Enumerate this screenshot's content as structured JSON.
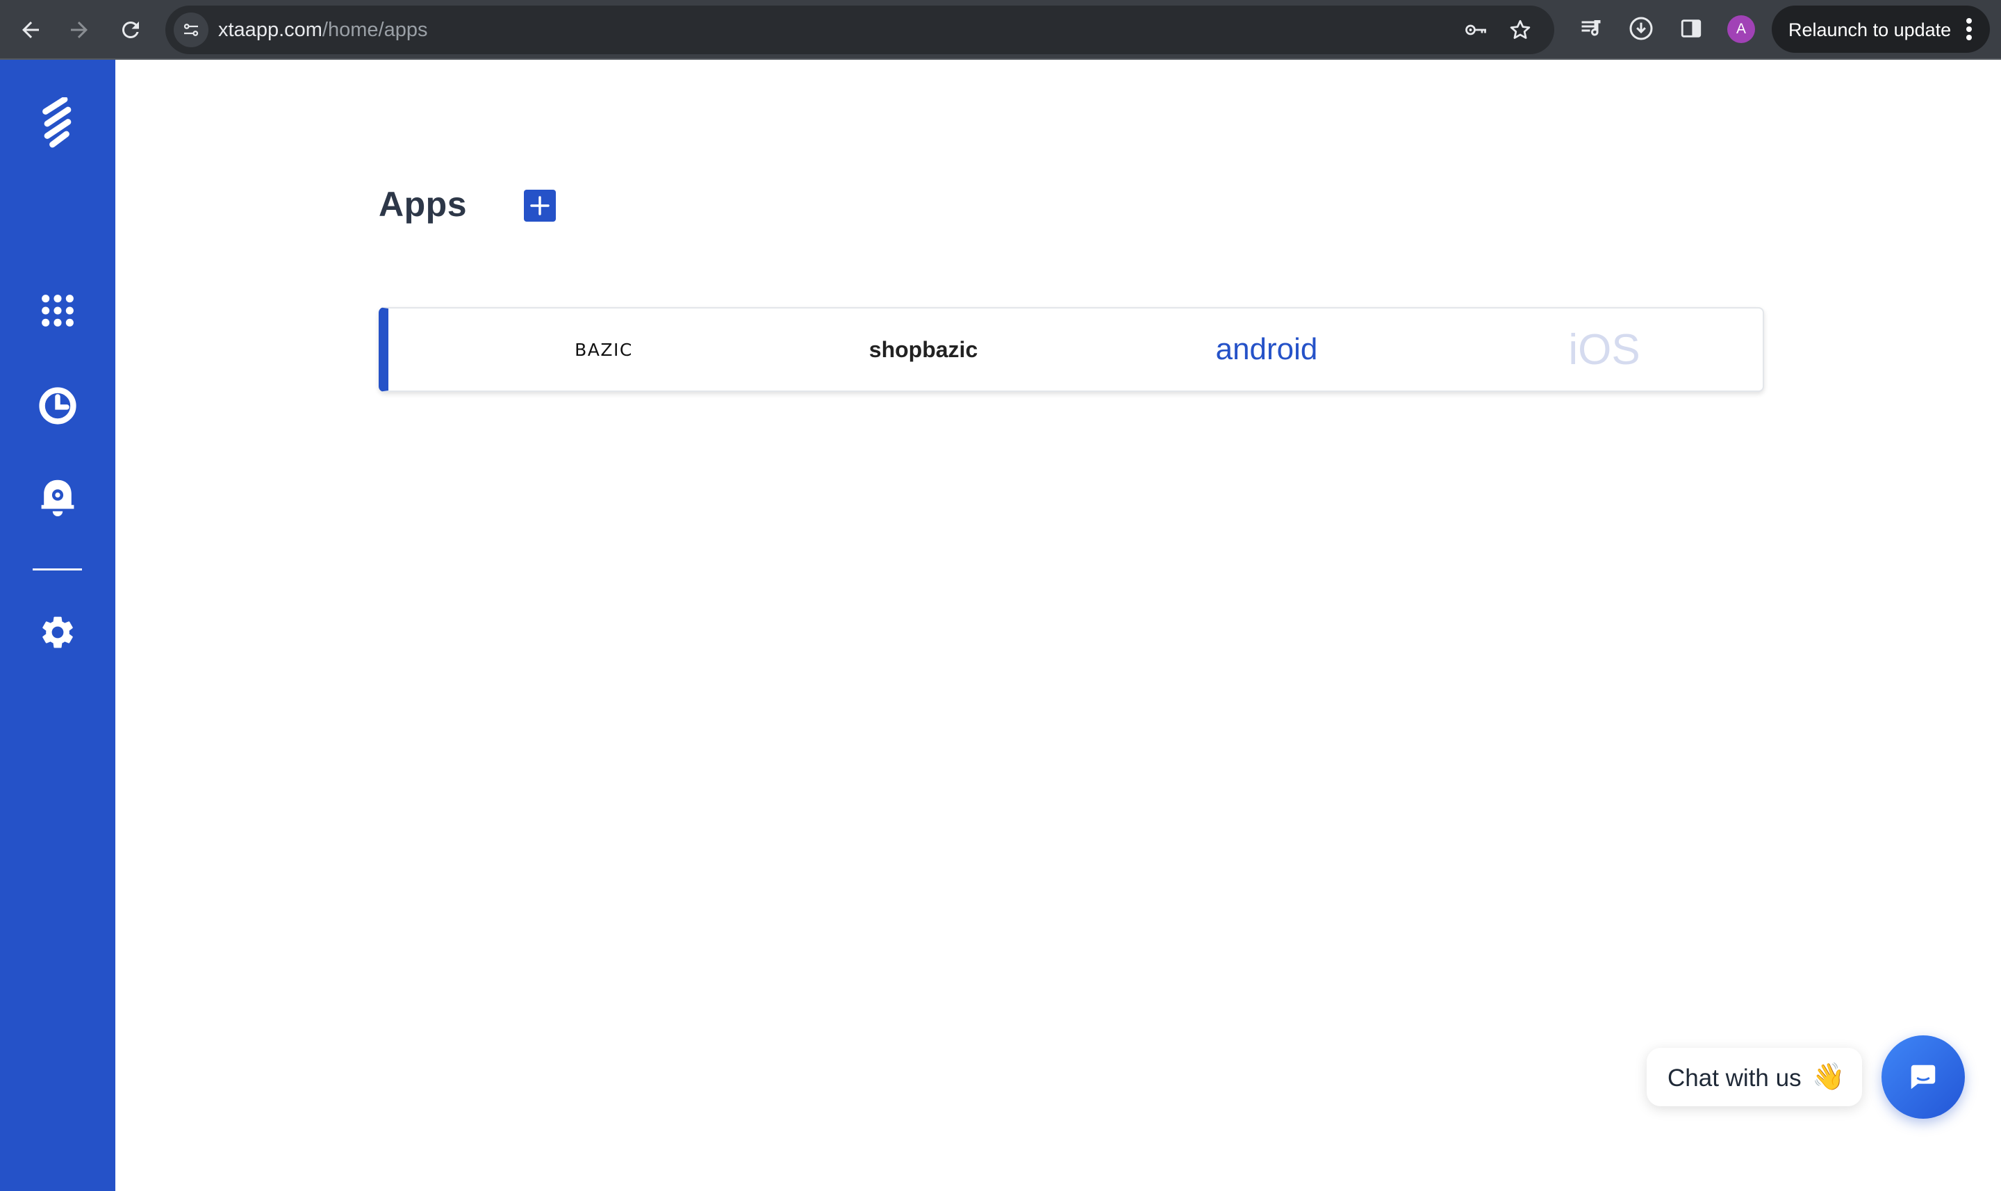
{
  "browser": {
    "url_host": "xtaapp.com",
    "url_path": "/home/apps",
    "profile_initial": "A",
    "relaunch_label": "Relaunch to update"
  },
  "sidebar": {
    "items": [
      {
        "icon": "logo-icon"
      },
      {
        "icon": "apps-grid-icon"
      },
      {
        "icon": "analytics-clock-icon"
      },
      {
        "icon": "notification-bell-gear-icon"
      },
      {
        "icon": "settings-gear-icon"
      }
    ],
    "color": "#2552c8"
  },
  "main": {
    "title": "Apps",
    "apps": [
      {
        "name": "BAZIC"
      },
      {
        "name": "shopbazic"
      },
      {
        "name": "android"
      },
      {
        "name": "iOS"
      }
    ]
  },
  "chat": {
    "label": "Chat with us",
    "emoji": "👋",
    "icon": "chat-icon"
  },
  "colors": {
    "accent": "#2552c8",
    "chrome_bg": "#3b3f45",
    "title": "#2d3748"
  }
}
